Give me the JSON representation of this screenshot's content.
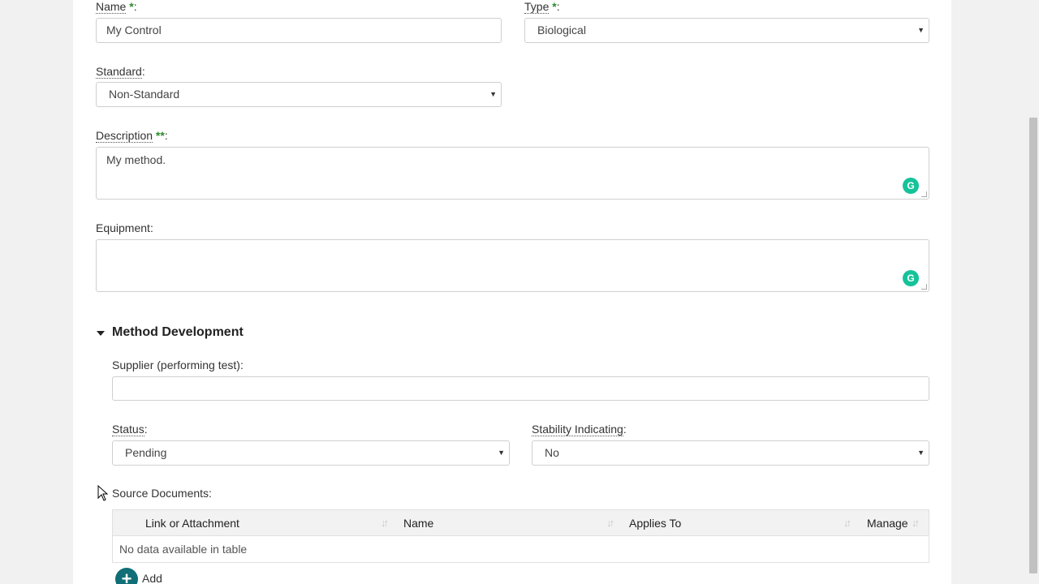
{
  "form": {
    "name": {
      "label": "Name",
      "required_mark": "*",
      "value": "My Control"
    },
    "type": {
      "label": "Type",
      "required_mark": "*",
      "value": "Biological"
    },
    "standard": {
      "label": "Standard",
      "value": "Non-Standard"
    },
    "description": {
      "label": "Description",
      "required_mark": "**",
      "value": "My method."
    },
    "equipment": {
      "label": "Equipment",
      "value": ""
    }
  },
  "method_development": {
    "title": "Method Development",
    "supplier": {
      "label": "Supplier (performing test):",
      "value": ""
    },
    "status": {
      "label": "Status",
      "value": "Pending"
    },
    "stability": {
      "label": "Stability Indicating",
      "value": "No"
    },
    "source_documents": {
      "label": "Source Documents:",
      "columns": [
        "Link or Attachment",
        "Name",
        "Applies To",
        "Manage"
      ],
      "empty_message": "No data available in table",
      "add_label": "Add"
    }
  },
  "icons": {
    "grammarly": "G",
    "add": "+",
    "caret": "▼",
    "sort": "↓↑"
  },
  "colors": {
    "required": "#2e8b2e",
    "add_button": "#0f6e76",
    "grammarly": "#15c39a"
  }
}
